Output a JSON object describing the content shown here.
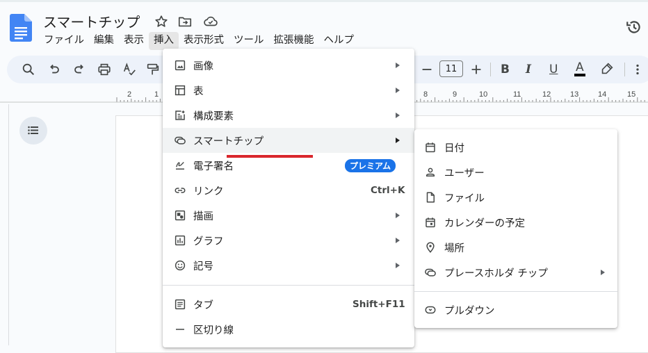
{
  "document": {
    "title": "スマートチップ"
  },
  "menubar": {
    "items": [
      {
        "label": "ファイル"
      },
      {
        "label": "編集"
      },
      {
        "label": "表示"
      },
      {
        "label": "挿入",
        "active": true
      },
      {
        "label": "表示形式"
      },
      {
        "label": "ツール"
      },
      {
        "label": "拡張機能"
      },
      {
        "label": "ヘルプ"
      }
    ]
  },
  "toolbar": {
    "font_size": "11",
    "bold": "B",
    "italic": "I",
    "underline": "U",
    "text_color": "A"
  },
  "ruler": {
    "labels": [
      "2",
      "1",
      "8",
      "9",
      "10",
      "11",
      "12",
      "13",
      "14",
      "15"
    ]
  },
  "insert_menu": {
    "items": [
      {
        "label": "画像",
        "icon": "image-icon",
        "submenu": true
      },
      {
        "label": "表",
        "icon": "table-icon",
        "submenu": true
      },
      {
        "label": "構成要素",
        "icon": "building-blocks-icon",
        "submenu": true
      },
      {
        "label": "スマートチップ",
        "icon": "smart-chip-icon",
        "submenu": true,
        "highlighted": true
      },
      {
        "label": "電子署名",
        "icon": "signature-icon",
        "badge": "プレミアム"
      },
      {
        "label": "リンク",
        "icon": "link-icon",
        "shortcut": "Ctrl+K"
      },
      {
        "label": "描画",
        "icon": "drawing-icon",
        "submenu": true
      },
      {
        "label": "グラフ",
        "icon": "chart-icon",
        "submenu": true
      },
      {
        "label": "記号",
        "icon": "emoji-icon",
        "submenu": true
      },
      {
        "label": "タブ",
        "icon": "tab-icon",
        "shortcut": "Shift+F11"
      },
      {
        "label": "区切り線",
        "icon": "horizontal-line-icon"
      }
    ]
  },
  "smart_chip_submenu": {
    "items": [
      {
        "label": "日付",
        "icon": "calendar-icon"
      },
      {
        "label": "ユーザー",
        "icon": "person-icon"
      },
      {
        "label": "ファイル",
        "icon": "file-icon"
      },
      {
        "label": "カレンダーの予定",
        "icon": "calendar-event-icon"
      },
      {
        "label": "場所",
        "icon": "place-icon"
      },
      {
        "label": "プレースホルダ チップ",
        "icon": "placeholder-chip-icon",
        "submenu": true
      },
      {
        "label": "プルダウン",
        "icon": "dropdown-icon"
      }
    ]
  },
  "colors": {
    "accent": "#1a73e8",
    "annotation_red": "#d9262c",
    "toolbar_bg": "#edf2fa"
  }
}
